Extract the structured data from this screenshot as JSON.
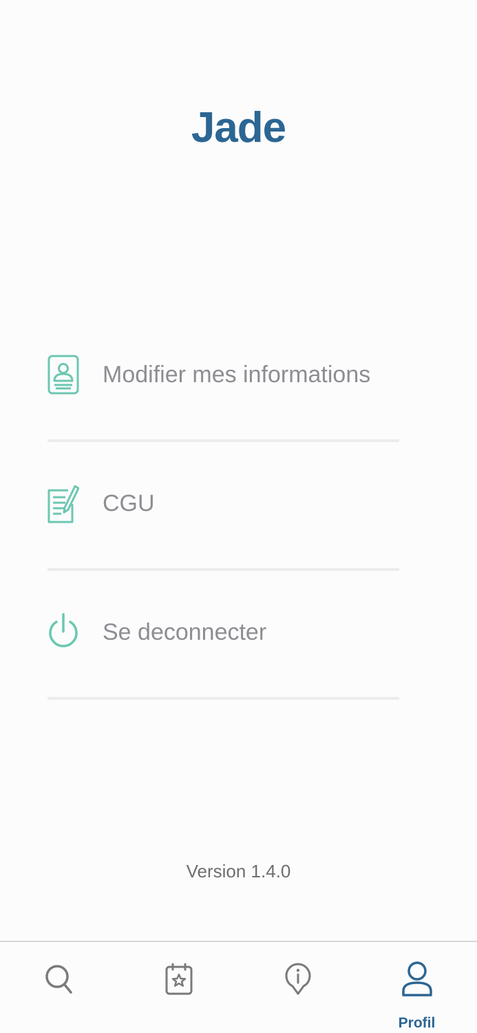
{
  "header": {
    "title": "Jade"
  },
  "menu": {
    "items": [
      {
        "label": "Modifier mes informations",
        "icon": "profile-card-icon"
      },
      {
        "label": "CGU",
        "icon": "document-edit-icon"
      },
      {
        "label": "Se deconnecter",
        "icon": "power-icon"
      }
    ]
  },
  "footer": {
    "version": "Version 1.4.0"
  },
  "tabbar": {
    "tabs": [
      {
        "icon": "search-icon",
        "label": ""
      },
      {
        "icon": "calendar-star-icon",
        "label": ""
      },
      {
        "icon": "info-pin-icon",
        "label": ""
      },
      {
        "icon": "user-icon",
        "label": "Profil",
        "active": true
      }
    ]
  },
  "colors": {
    "brand": "#2c6693",
    "icon_accent": "#6cc7b2",
    "menu_text": "#8d8d93",
    "inactive_tab": "#7a7a7a",
    "divider": "#ececec"
  }
}
